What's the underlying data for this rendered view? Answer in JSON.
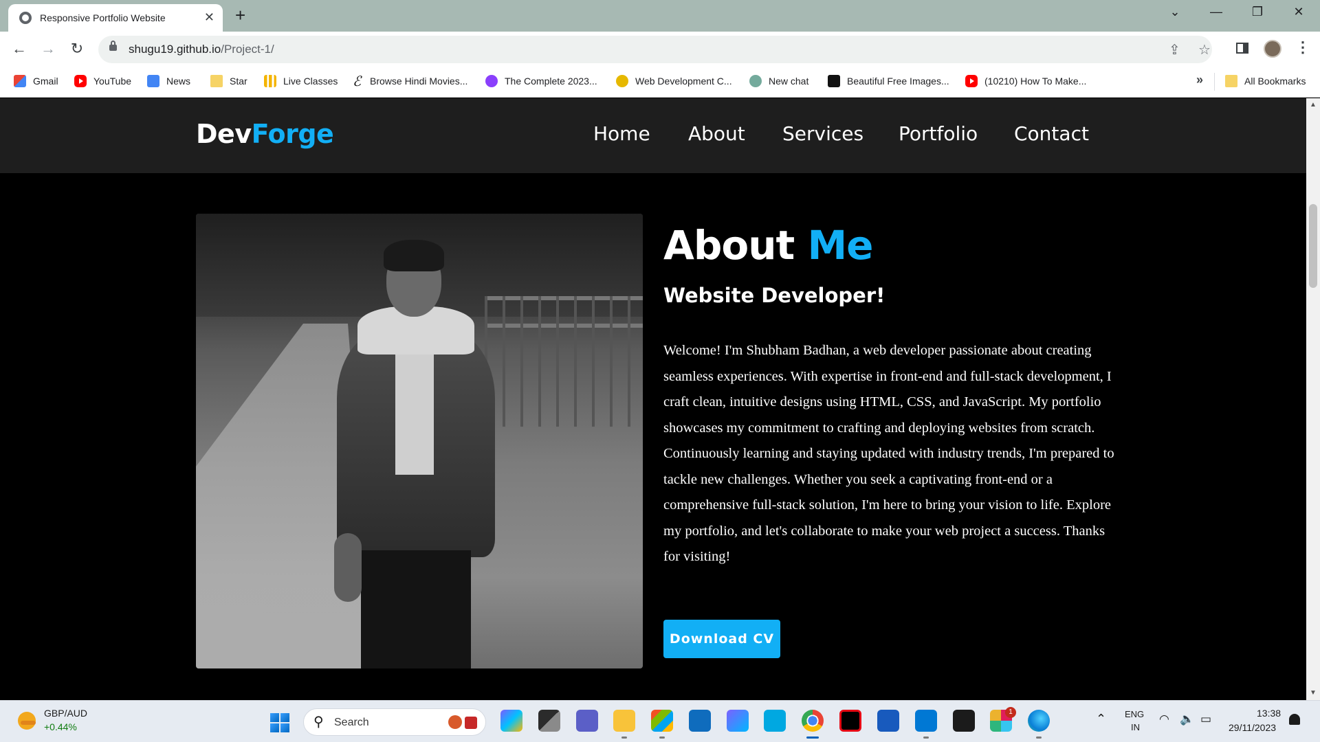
{
  "browser": {
    "tab_title": "Responsive Portfolio Website",
    "tab_close": "✕",
    "new_tab": "+",
    "window_controls": {
      "tabs_menu": "⌄",
      "minimize": "—",
      "restore": "❐",
      "close": "✕"
    },
    "url_host": "shugu19.github.io",
    "url_path": "/Project-1/",
    "nav": {
      "back": "←",
      "forward": "→",
      "reload": "↻"
    },
    "omnibox_icons": {
      "share": "⇪",
      "bookmark_star": "☆"
    },
    "menu": "⋮",
    "bookmarks": [
      {
        "label": "Gmail",
        "icon": "gmail-icon"
      },
      {
        "label": "YouTube",
        "icon": "youtube-icon"
      },
      {
        "label": "News",
        "icon": "google-news-icon"
      },
      {
        "label": "Star",
        "icon": "folder-icon"
      },
      {
        "label": "Live Classes",
        "icon": "bars-icon"
      },
      {
        "label": "Browse Hindi Movies...",
        "icon": "script-e-icon"
      },
      {
        "label": "The Complete 2023...",
        "icon": "udemy-icon"
      },
      {
        "label": "Web Development C...",
        "icon": "coin-icon"
      },
      {
        "label": "New chat",
        "icon": "chatgpt-icon"
      },
      {
        "label": "Beautiful Free Images...",
        "icon": "unsplash-icon"
      },
      {
        "label": "(10210) How To Make...",
        "icon": "youtube-icon"
      }
    ],
    "bookmarks_more": "»",
    "all_bookmarks": "All Bookmarks"
  },
  "site": {
    "logo_main": "Dev",
    "logo_accent": "Forge",
    "nav": [
      "Home",
      "About",
      "Services",
      "Portfolio",
      "Contact"
    ],
    "about": {
      "title_main": "About ",
      "title_accent": "Me",
      "subtitle": "Website Developer!",
      "bio": "Welcome! I'm Shubham Badhan, a web developer passionate about creating seamless experiences. With expertise in front-end and full-stack development, I craft clean, intuitive designs using HTML, CSS, and JavaScript. My portfolio showcases my commitment to crafting and deploying websites from scratch. Continuously learning and staying updated with industry trends, I'm prepared to tackle new challenges. Whether you seek a captivating front-end or a comprehensive full-stack solution, I'm here to bring your vision to life. Explore my portfolio, and let's collaborate to make your web project a success. Thanks for visiting!",
      "cta": "Download CV"
    },
    "accent_color": "#12aff5"
  },
  "scrollbar": {
    "up": "▲",
    "down": "▼"
  },
  "taskbar": {
    "ticker_name": "GBP/AUD",
    "ticker_change": "+0.44%",
    "search_label": "Search",
    "search_icon": "⚲",
    "apps": [
      "copilot-icon",
      "task-view-icon",
      "teams-icon",
      "file-explorer-icon",
      "microsoft-store-icon",
      "mail-icon",
      "app-icon",
      "prime-video-icon",
      "chrome-icon",
      "netflix-icon",
      "word-icon",
      "vscode-icon",
      "terminal-icon",
      "slack-icon",
      "edge-icon"
    ],
    "slack_badge": "1",
    "tray_up": "⌃",
    "lang_line1": "ENG",
    "lang_line2": "IN",
    "tray_icons": {
      "wifi": "◠",
      "volume": "🔈",
      "battery": "▭"
    },
    "time": "13:38",
    "date": "29/11/2023"
  }
}
